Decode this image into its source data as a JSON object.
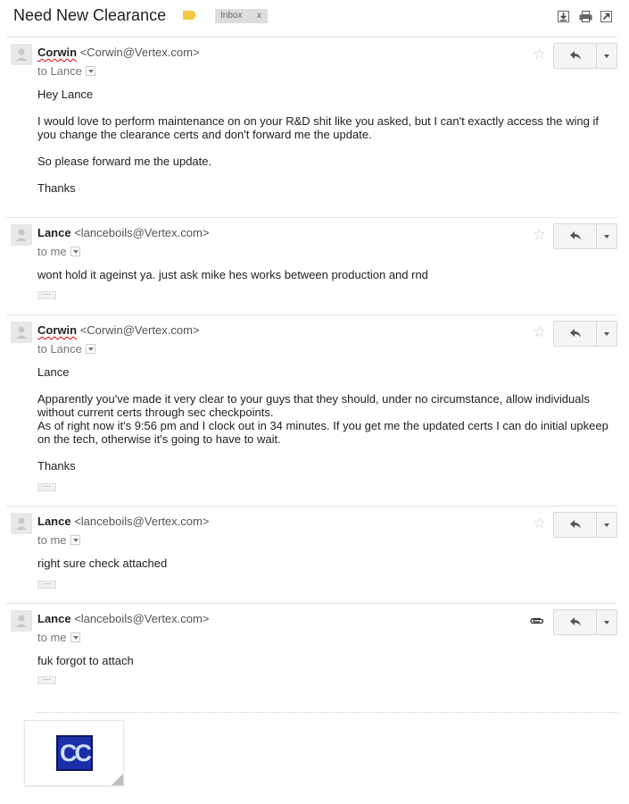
{
  "thread": {
    "subject": "Need New Clearance",
    "inbox_chip": "Inbox",
    "inbox_chip_close": "x"
  },
  "messages": [
    {
      "sender_name": "Corwin",
      "sender_email": "<Corwin@Vertex.com>",
      "to": "to Lance",
      "body": [
        "Hey Lance",
        "I would love to perform maintenance on on your R&D shit like you asked, but I can't exactly access the wing if you change the clearance certs and don't forward me the update.",
        "So please forward me the update.",
        "Thanks"
      ]
    },
    {
      "sender_name": "Lance",
      "sender_email": "<lanceboils@Vertex.com>",
      "to": "to me",
      "body": [
        "wont hold it ageinst ya. just ask mike hes works between production and rnd"
      ],
      "ellipsis": "···"
    },
    {
      "sender_name": "Corwin",
      "sender_email": "<Corwin@Vertex.com>",
      "to": "to Lance",
      "body": [
        "Lance",
        "Apparently you've made it very clear to your guys that they should, under no circumstance, allow individuals without current certs through sec checkpoints.",
        "As of right now it's 9:56 pm and I clock out in 34 minutes. If you get me the updated certs I can do initial upkeep on the tech, otherwise it's going to have to wait.",
        "Thanks"
      ],
      "ellipsis": "···"
    },
    {
      "sender_name": "Lance",
      "sender_email": "<lanceboils@Vertex.com>",
      "to": "to me",
      "body": [
        "right sure check attached"
      ],
      "ellipsis": "···"
    },
    {
      "sender_name": "Lance",
      "sender_email": "<lanceboils@Vertex.com>",
      "to": "to me",
      "body": [
        "fuk forgot to attach"
      ],
      "ellipsis": "···"
    }
  ],
  "attachment": {
    "logo_text": "CC"
  },
  "colors": {
    "label_tag": "#f5c842",
    "logo_bg": "#1a2fa8"
  },
  "icons": [
    "label-icon",
    "download-icon",
    "print-icon",
    "new-window-icon",
    "avatar-icon",
    "star-icon",
    "reply-icon",
    "more-dropdown-icon",
    "paperclip-icon"
  ]
}
